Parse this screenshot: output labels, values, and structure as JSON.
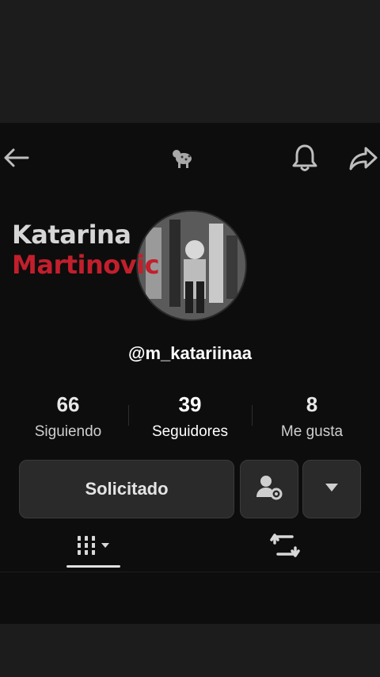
{
  "profile": {
    "name_first": "Katarina",
    "name_last": "Martinovic",
    "username": "@m_katariinaa"
  },
  "stats": [
    {
      "value": "66",
      "label": "Siguiendo"
    },
    {
      "value": "39",
      "label": "Seguidores"
    },
    {
      "value": "8",
      "label": "Me gusta"
    }
  ],
  "actions": {
    "request_label": "Solicitado"
  },
  "icons": {
    "back": "arrow-left-icon",
    "mascot": "leopard-icon",
    "bell": "bell-icon",
    "share": "share-arrow-icon",
    "friends": "user-settings-icon",
    "more": "triangle-down-icon",
    "grid_tab": "grid-icon",
    "repost_tab": "repost-icon"
  },
  "colors": {
    "accent_red": "#c21f2c",
    "background": "#0d0d0d"
  }
}
